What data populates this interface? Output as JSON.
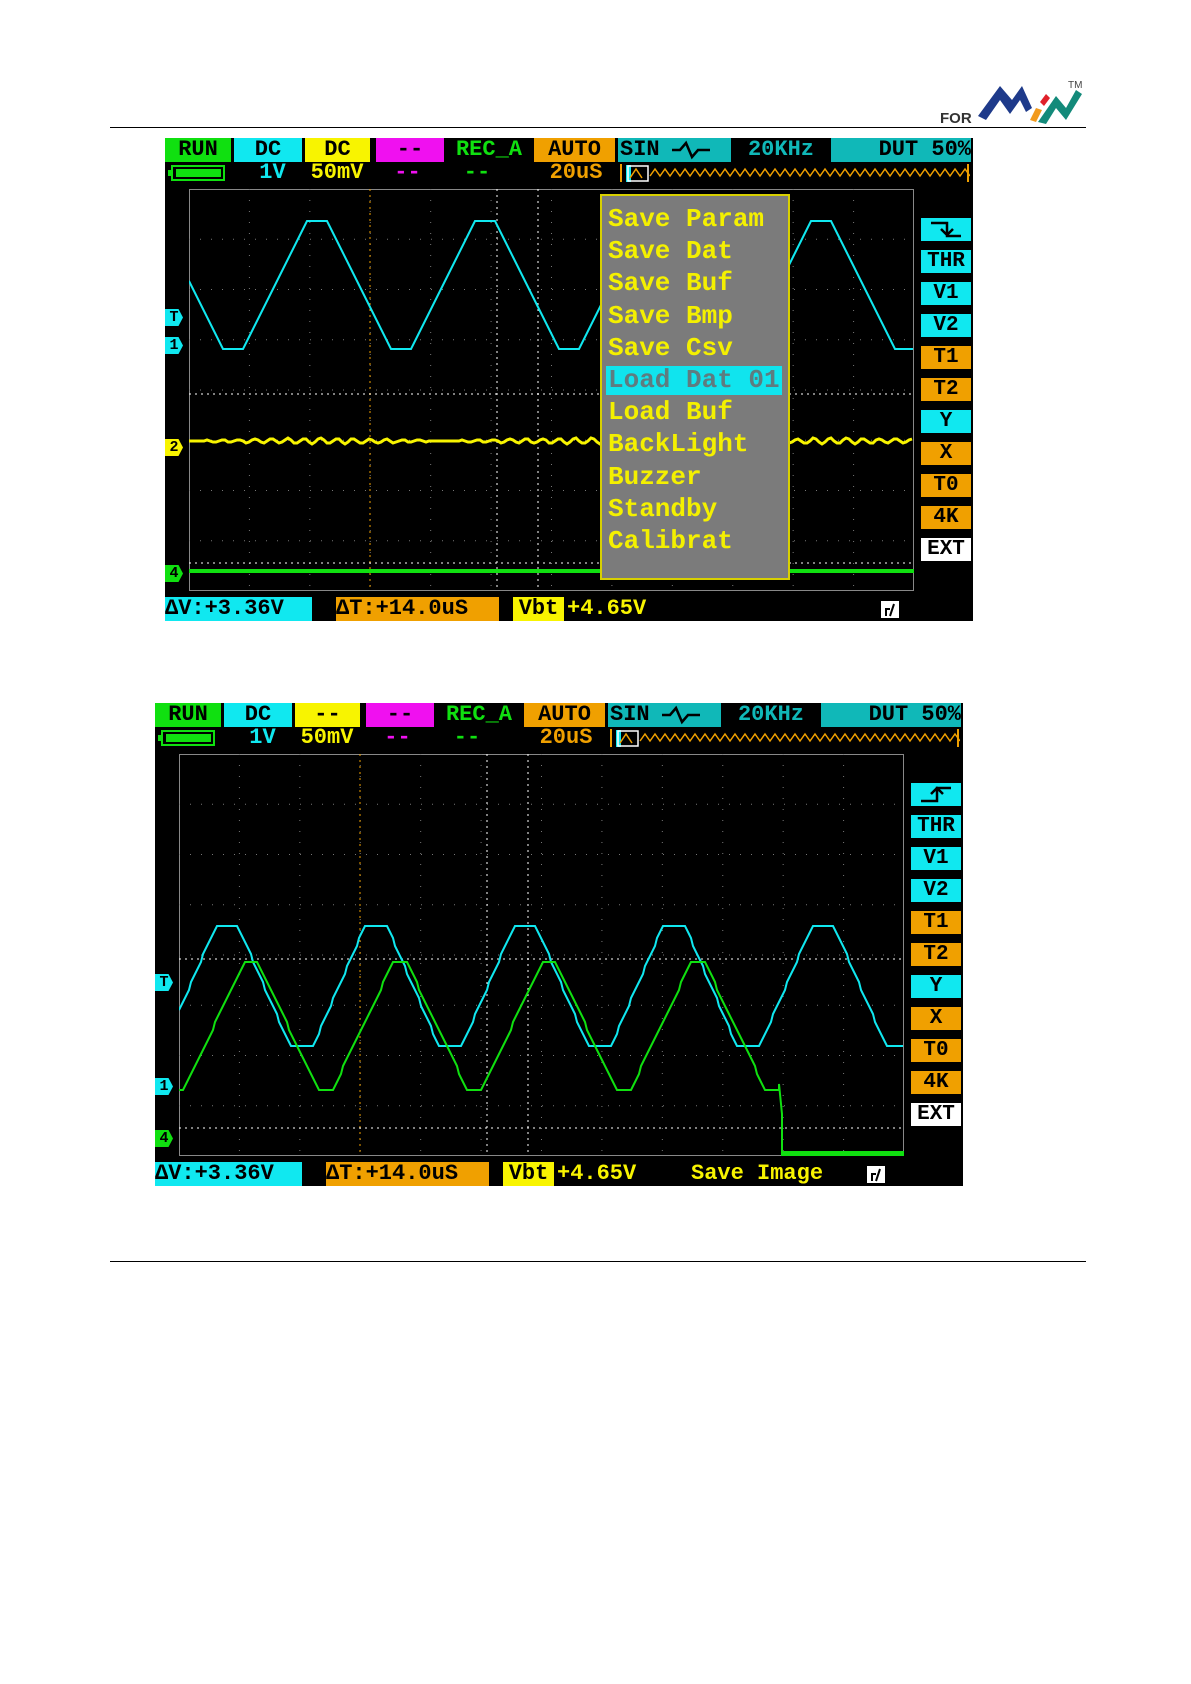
{
  "page": {
    "logo_text": "FOR",
    "logo_tm": "TM"
  },
  "colors": {
    "cyan": "#10e8f0",
    "yellow": "#f8f400",
    "magenta": "#f010f0",
    "green": "#10e010",
    "orange": "#f0a000",
    "teal": "#10b8b8"
  },
  "screens": [
    {
      "header": {
        "mode": "RUN",
        "ch1_coupling": "DC",
        "ch2_coupling": "DC",
        "ch3_coupling": "--",
        "rec": "REC_A",
        "trig_mode": "AUTO",
        "wave": "SIN",
        "freq": "20KHz",
        "duty": "DUT 50%",
        "ch1_scale": "1V",
        "ch2_scale": "50mV",
        "ch3_scale": "--",
        "ch4_scale": "--",
        "timebase": "20uS"
      },
      "trigger_edge": "falling-edge-icon",
      "side_buttons": [
        "THR",
        "V1",
        "V2",
        "T1",
        "T2",
        "Y",
        "X",
        "T0",
        "4K",
        "EXT"
      ],
      "markers": [
        "T",
        "1",
        "2",
        "4"
      ],
      "status": {
        "dv": "ΔV:+3.36V",
        "dt": "ΔT:+14.0uS",
        "vbt_label": "Vbt",
        "vbt": "+4.65V",
        "message": ""
      },
      "menu": {
        "items": [
          "Save Param",
          "Save Dat",
          "Save Buf",
          "Save Bmp",
          "Save Csv",
          "Load Dat 01",
          "Load Buf",
          "BackLight",
          "Buzzer",
          "Standby",
          "Calibrat"
        ],
        "selected": 5
      }
    },
    {
      "header": {
        "mode": "RUN",
        "ch1_coupling": "DC",
        "ch2_coupling": "--",
        "ch3_coupling": "--",
        "rec": "REC_A",
        "trig_mode": "AUTO",
        "wave": "SIN",
        "freq": "20KHz",
        "duty": "DUT 50%",
        "ch1_scale": "1V",
        "ch2_scale": "50mV",
        "ch3_scale": "--",
        "ch4_scale": "--",
        "timebase": "20uS"
      },
      "trigger_edge": "rising-edge-icon",
      "side_buttons": [
        "THR",
        "V1",
        "V2",
        "T1",
        "T2",
        "Y",
        "X",
        "T0",
        "4K",
        "EXT"
      ],
      "markers": [
        "T",
        "1",
        "4"
      ],
      "status": {
        "dv": "ΔV:+3.36V",
        "dt": "ΔT:+14.0uS",
        "vbt_label": "Vbt",
        "vbt": "+4.65V",
        "message": "Save Image"
      }
    }
  ]
}
